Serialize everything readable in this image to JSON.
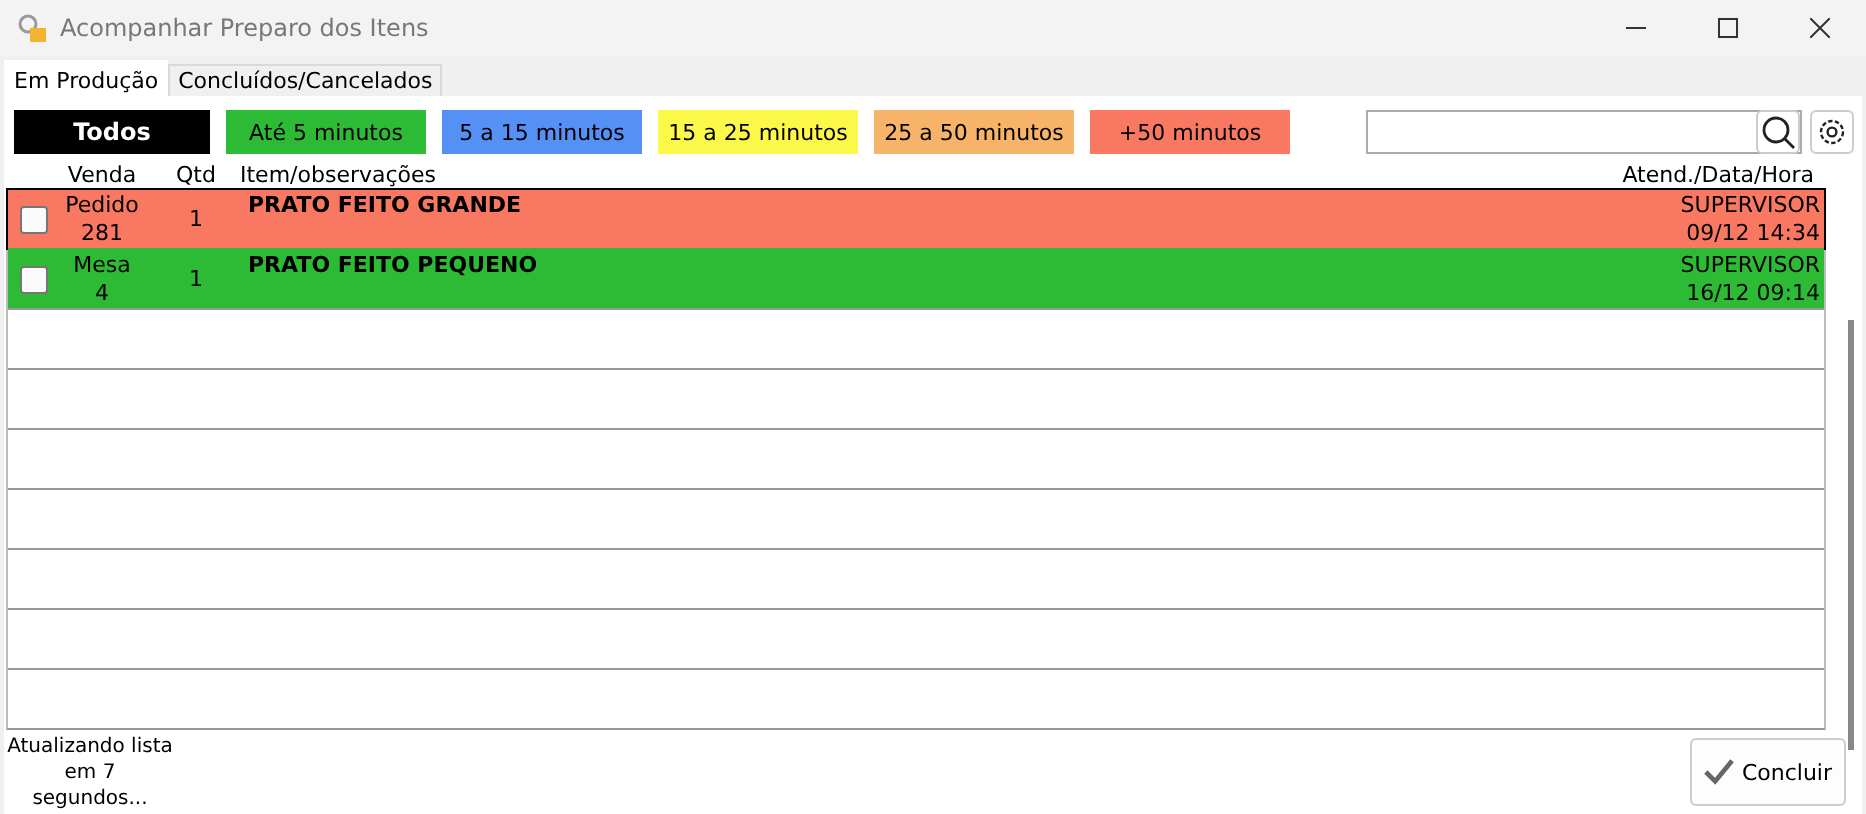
{
  "window": {
    "title": "Acompanhar Preparo dos Itens"
  },
  "tabs": [
    {
      "label": "Em Produção",
      "selected": true
    },
    {
      "label": "Concluídos/Cancelados",
      "selected": false
    }
  ],
  "filters": [
    {
      "label": "Todos",
      "color": "#000000",
      "selected": true
    },
    {
      "label": "Até 5 minutos",
      "color": "#2dbb36",
      "selected": false
    },
    {
      "label": "5 a 15 minutos",
      "color": "#5591f5",
      "selected": false
    },
    {
      "label": "15 a 25 minutos",
      "color": "#fbf84a",
      "selected": false
    },
    {
      "label": "25 a 50 minutos",
      "color": "#f7b468",
      "selected": false
    },
    {
      "label": "+50 minutos",
      "color": "#f87862",
      "selected": false
    }
  ],
  "table": {
    "columns": [
      "Venda",
      "Qtd",
      "Item/observações",
      "Atend./Data/Hora"
    ],
    "rows": [
      {
        "checked": false,
        "selected": true,
        "color": "#f87862",
        "sale_type": "Pedido",
        "sale_number": "281",
        "qty": "1",
        "item": "PRATO FEITO GRANDE",
        "attendant": "SUPERVISOR",
        "datetime": "09/12 14:34"
      },
      {
        "checked": false,
        "selected": false,
        "color": "#2dbb36",
        "sale_type": "Mesa",
        "sale_number": "4",
        "qty": "1",
        "item": "PRATO FEITO PEQUENO",
        "attendant": "SUPERVISOR",
        "datetime": "16/12 09:14"
      }
    ]
  },
  "status": "Atualizando lista em 7 segundos...",
  "buttons": [
    "Concluir"
  ]
}
